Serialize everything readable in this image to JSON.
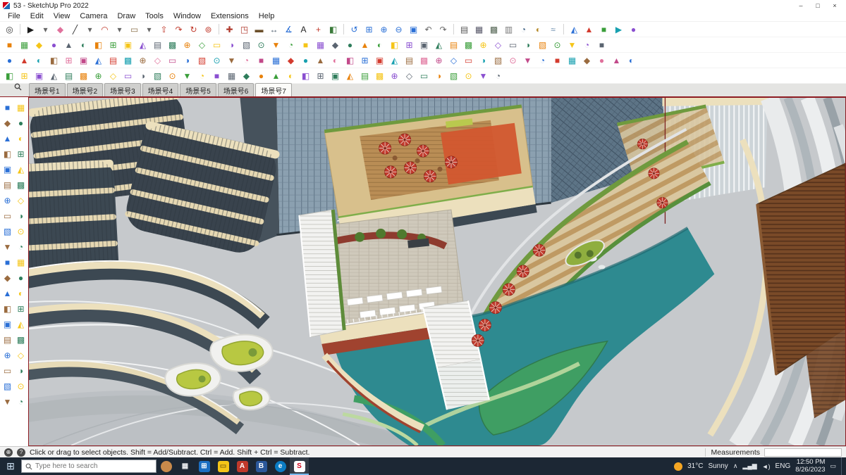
{
  "window": {
    "title": "53 - SketchUp Pro 2022",
    "controls": {
      "minimize": "–",
      "maximize": "□",
      "close": "×"
    }
  },
  "menu": {
    "items": [
      "File",
      "Edit",
      "View",
      "Camera",
      "Draw",
      "Tools",
      "Window",
      "Extensions",
      "Help"
    ]
  },
  "toolbars": {
    "glyph_cycle": [
      "■",
      "▦",
      "◆",
      "●",
      "▲",
      "◐",
      "◧",
      "⊞",
      "▣",
      "◭",
      "▤",
      "▩",
      "⊕",
      "◇",
      "▭",
      "◑",
      "▧",
      "⊙",
      "▼",
      "◔"
    ],
    "color_cycle": [
      "#e8820c",
      "#2a6fd6",
      "#3a9e3a",
      "#d33b2e",
      "#f5c518",
      "#18a0b0",
      "#8a4fd0",
      "#9a6b3f",
      "#5a6470",
      "#e0719c",
      "#2e7d5b",
      "#c24a8a"
    ],
    "row1": [
      {
        "n": "zoom-tool",
        "g": "◎",
        "c": "#3a3a3a"
      },
      {
        "s": 1
      },
      {
        "n": "select",
        "g": "▶",
        "c": "#1a1a1a"
      },
      {
        "n": "select-dropdown",
        "g": "▾",
        "c": "#666"
      },
      {
        "n": "eraser",
        "g": "◆",
        "c": "#e0719c"
      },
      {
        "n": "line",
        "g": "╱",
        "c": "#333"
      },
      {
        "n": "line-dropdown",
        "g": "▾",
        "c": "#666"
      },
      {
        "n": "arc",
        "g": "◠",
        "c": "#c0392b"
      },
      {
        "n": "arc-dropdown",
        "g": "▾",
        "c": "#666"
      },
      {
        "n": "rectangle",
        "g": "▭",
        "c": "#8a6f4a"
      },
      {
        "n": "shape-dropdown",
        "g": "▾",
        "c": "#666"
      },
      {
        "n": "push-pull",
        "g": "⇧",
        "c": "#c0392b"
      },
      {
        "n": "follow-me",
        "g": "↷",
        "c": "#c0392b"
      },
      {
        "n": "rotate",
        "g": "↻",
        "c": "#c0392b"
      },
      {
        "n": "offset",
        "g": "⊚",
        "c": "#c0392b"
      },
      {
        "s": 1
      },
      {
        "n": "move",
        "g": "✚",
        "c": "#b03a2e"
      },
      {
        "n": "scale",
        "g": "◳",
        "c": "#b03a2e"
      },
      {
        "n": "tape-measure",
        "g": "▬",
        "c": "#6b4f2a"
      },
      {
        "n": "dimension",
        "g": "↔",
        "c": "#445566"
      },
      {
        "n": "protractor",
        "g": "∡",
        "c": "#2a6fd6"
      },
      {
        "n": "text-tool",
        "g": "A",
        "c": "#222"
      },
      {
        "n": "axes",
        "g": "+",
        "c": "#c0392b"
      },
      {
        "n": "section-plane",
        "g": "◧",
        "c": "#3a7a3a"
      },
      {
        "s": 1
      },
      {
        "n": "orbit",
        "g": "↺",
        "c": "#2a6fd6"
      },
      {
        "n": "pan",
        "g": "⊞",
        "c": "#2a6fd6"
      },
      {
        "n": "zoom-in",
        "g": "⊕",
        "c": "#2a6fd6"
      },
      {
        "n": "zoom-out",
        "g": "⊖",
        "c": "#2a6fd6"
      },
      {
        "n": "zoom-extents",
        "g": "▣",
        "c": "#2a6fd6"
      },
      {
        "n": "previous-view",
        "g": "↶",
        "c": "#666"
      },
      {
        "n": "next-view",
        "g": "↷",
        "c": "#666"
      },
      {
        "s": 1
      },
      {
        "n": "wireframe-style",
        "g": "▤",
        "c": "#555"
      },
      {
        "n": "shaded-style",
        "g": "▦",
        "c": "#556"
      },
      {
        "n": "textured-style",
        "g": "▩",
        "c": "#565"
      },
      {
        "n": "monochrome-style",
        "g": "▥",
        "c": "#777"
      },
      {
        "n": "xray-style",
        "g": "◔",
        "c": "#446688"
      },
      {
        "n": "shadows-toggle",
        "g": "◐",
        "c": "#b58a2a"
      },
      {
        "n": "fog-toggle",
        "g": "≈",
        "c": "#6688aa"
      },
      {
        "s": 1
      },
      {
        "n": "iso-view",
        "g": "◭",
        "c": "#2a6fd6"
      },
      {
        "n": "top-view",
        "g": "▲",
        "c": "#d33b2e"
      },
      {
        "n": "front-view",
        "g": "■",
        "c": "#3a9e3a"
      },
      {
        "n": "right-view",
        "g": "▶",
        "c": "#18a0b0"
      },
      {
        "n": "back-view",
        "g": "●",
        "c": "#8a4fd0"
      }
    ],
    "row2": [
      "make-component",
      "component-options",
      "dynamic-components",
      "interact",
      "3d-warehouse",
      "extension-warehouse",
      "materials",
      "paint-bucket",
      "styles",
      "layers-panel",
      "outliner",
      "entity-info",
      "model-info",
      "purge-unused",
      "union",
      "subtract",
      "trim",
      "intersect",
      "outer-shell",
      "split",
      "solid-tools-options",
      "sandbox-from-contours",
      "sandbox-from-scratch",
      "smoove",
      "stamp",
      "drape",
      "add-detail",
      "flip-edge",
      "tag-manager",
      "scenes-panel",
      "animation-play",
      "shadows-panel",
      "fog-panel",
      "match-photo",
      "import-image",
      "export-2d",
      "export-3d",
      "section-cuts",
      "section-fill",
      "back-edges-toggle",
      "perspective-toggle"
    ],
    "row3": [
      "fredo-scale",
      "round-corner",
      "curviloft",
      "joint-push-pull",
      "soap-skin-bubble",
      "artisan-sculpt",
      "vertex-tools",
      "quadface-tools",
      "subd-smooth",
      "cleanup-model",
      "solid-inspector",
      "clothworks",
      "profile-builder",
      "skimp-import",
      "transmutr",
      "skatter",
      "curic-section",
      "s4u-slice",
      "selection-toys",
      "mirror-tool",
      "weld-edges",
      "bezier-curve",
      "taper-maker",
      "shell-tool",
      "lattice-maker",
      "pipe-along-path",
      "follow-and-rotate",
      "drop-to-ground",
      "raytrace-render",
      "sun-north",
      "solar-analysis",
      "component-replacer",
      "random-rotate",
      "grid-tools",
      "edge-tools",
      "contour-maker",
      "terrain-flatten",
      "path-copy",
      "array-linear",
      "array-radial",
      "component-stringer",
      "random-select",
      "isolate-selection"
    ],
    "row4": [
      "material-replacer",
      "color-editor",
      "uv-toolkit",
      "thru-paint",
      "quad-uv-map",
      "texture-positioner",
      "align-tool",
      "cad-cleanup",
      "make-fur",
      "ivy-generator",
      "mirror-instance",
      "super-weld",
      "smart-offset",
      "angle-dimension",
      "label-maker",
      "zoom-selection",
      "view-parallel",
      "view-two-point",
      "walkthrough-tool",
      "scene-transition",
      "export-animation",
      "hide-rest-of-model",
      "unhide-all",
      "layer-color-toggle",
      "guide-tools",
      "delete-guides",
      "measure-area",
      "measure-volume",
      "report-generator",
      "attribute-editor",
      "ifc-export",
      "dwg-export",
      "print-layout",
      "send-to-layout"
    ]
  },
  "left_toolbar": [
    "select",
    "make-component",
    "paint-bucket",
    "eraser",
    "rectangle",
    "line",
    "circle",
    "arc",
    "polygon",
    "freehand",
    "move",
    "push-pull",
    "rotate",
    "follow-me",
    "scale",
    "offset",
    "tape-measure",
    "dimension",
    "protractor",
    "text",
    "axes",
    "3d-text",
    "orbit",
    "pan",
    "zoom",
    "zoom-window",
    "zoom-extents",
    "previous-view",
    "position-camera",
    "walk",
    "look-around",
    "section-plane",
    "add-location",
    "match-photo",
    "styles-toggle",
    "shadows-toggle",
    "xray-toggle",
    "back-edges",
    "hide-selected",
    "unhide-last"
  ],
  "scene_tabs": {
    "labels": [
      "场景号1",
      "场景号2",
      "场景号3",
      "场景号4",
      "场景号5",
      "场景号6",
      "场景号7"
    ],
    "active": "场景号7"
  },
  "status_bar": {
    "hint": "Click or drag to select objects. Shift = Add/Subtract. Ctrl = Add. Shift + Ctrl = Subtract.",
    "measurements_label": "Measurements",
    "measurements_value": ""
  },
  "taskbar": {
    "search_placeholder": "Type here to search",
    "apps": [
      {
        "n": "pinned-avatar",
        "g": "",
        "bg": "#c98a4b",
        "fg": "#fff",
        "round": true
      },
      {
        "n": "task-view",
        "g": "▦",
        "bg": "transparent",
        "fg": "#e8eaed"
      },
      {
        "n": "microsoft-store",
        "g": "⊞",
        "bg": "#1b6ec2",
        "fg": "#fff"
      },
      {
        "n": "file-explorer",
        "g": "▭",
        "bg": "#f5c518",
        "fg": "#8a6a10"
      },
      {
        "n": "app-red-a",
        "g": "A",
        "bg": "#c0392b",
        "fg": "#fff"
      },
      {
        "n": "app-blue",
        "g": "B",
        "bg": "#2b579a",
        "fg": "#fff"
      },
      {
        "n": "edge-browser",
        "g": "e",
        "bg": "#0b7cc4",
        "fg": "#fff",
        "round": true
      },
      {
        "n": "sketchup-app",
        "g": "S",
        "bg": "#ffffff",
        "fg": "#d0021b",
        "active": true
      }
    ],
    "tray": {
      "weather_temp": "31°C",
      "weather_desc": "Sunny",
      "lang": "ENG",
      "time": "12:50 PM",
      "date": "8/26/2023"
    }
  }
}
